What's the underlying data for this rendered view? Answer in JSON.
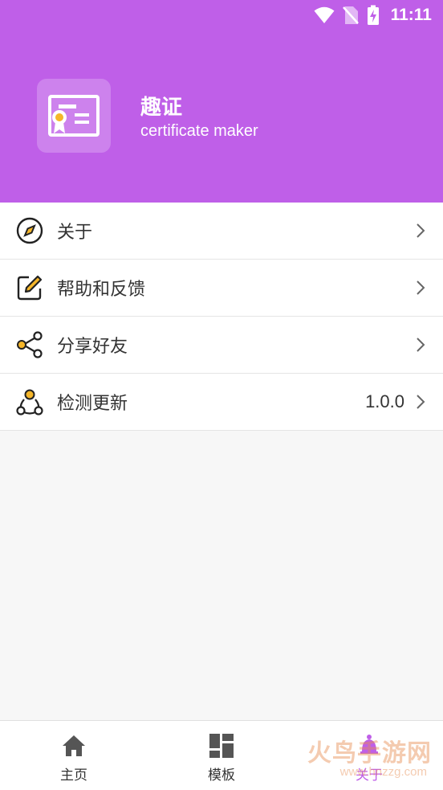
{
  "status_bar": {
    "time": "11:11",
    "icons": [
      "wifi-icon",
      "no-sim-icon",
      "battery-charging-icon"
    ]
  },
  "header": {
    "app_name": "趣证",
    "app_subtitle": "certificate maker",
    "logo_icon": "certificate-icon",
    "background_color": "#bf5fe8"
  },
  "menu": {
    "items": [
      {
        "label": "关于",
        "icon": "compass-icon"
      },
      {
        "label": "帮助和反馈",
        "icon": "edit-icon"
      },
      {
        "label": "分享好友",
        "icon": "share-icon"
      },
      {
        "label": "检测更新",
        "icon": "update-icon",
        "value": "1.0.0"
      }
    ]
  },
  "bottom_nav": {
    "items": [
      {
        "label": "主页",
        "icon": "home-icon",
        "active": false
      },
      {
        "label": "模板",
        "icon": "template-icon",
        "active": false
      },
      {
        "label": "关于",
        "icon": "about-icon",
        "active": true
      }
    ]
  },
  "watermark": {
    "text": "火鸟手游网",
    "subtext": "www.hnzzg.com"
  },
  "colors": {
    "accent": "#bf5fe8",
    "icon_highlight": "#f5b62a"
  }
}
